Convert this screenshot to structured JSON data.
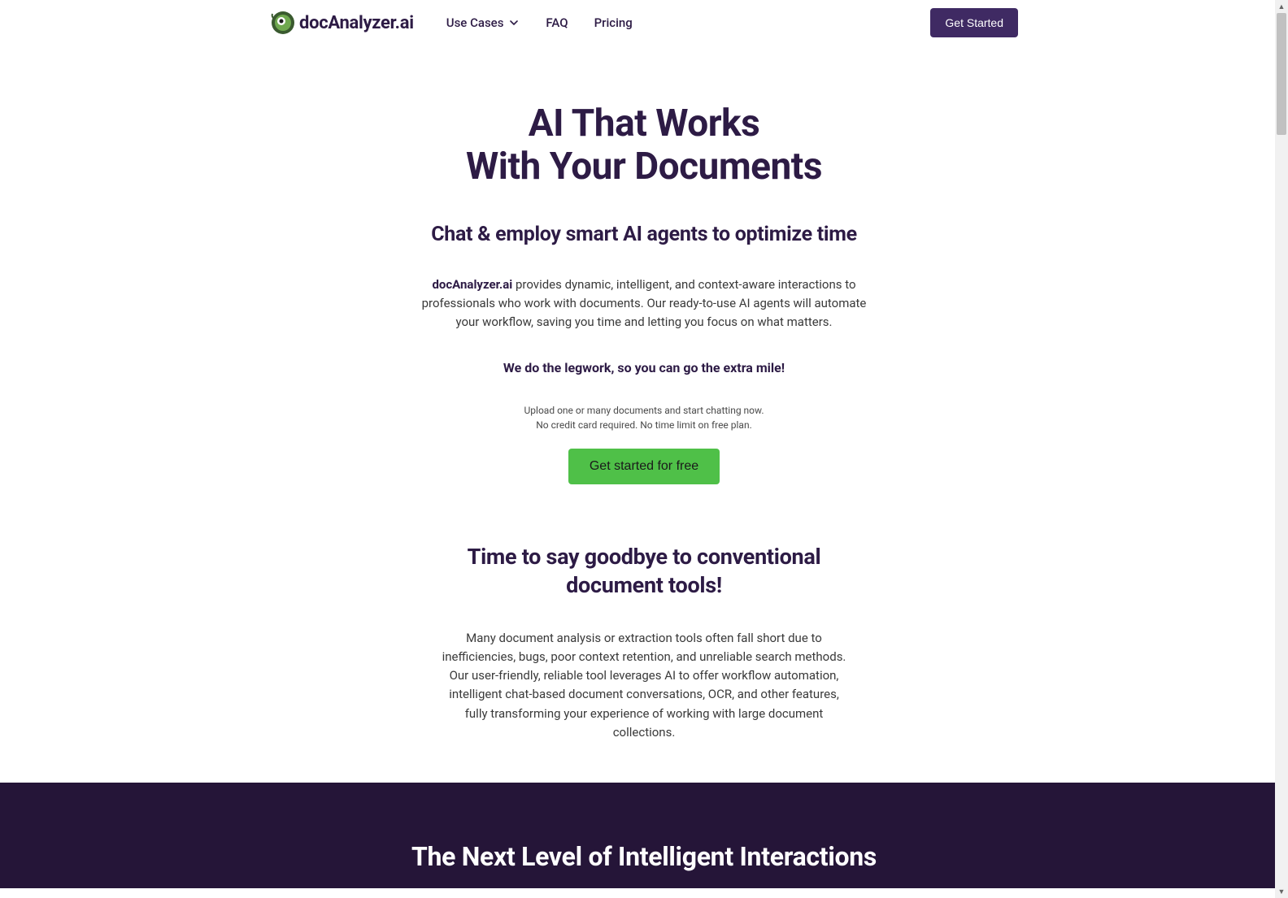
{
  "header": {
    "logo_text": "docAnalyzer.ai",
    "nav": {
      "use_cases": "Use Cases",
      "faq": "FAQ",
      "pricing": "Pricing"
    },
    "get_started_label": "Get Started"
  },
  "hero": {
    "title_line1": "AI That Works",
    "title_line2": "With Your Documents",
    "subtitle": "Chat & employ smart AI agents to optimize time",
    "description_bold": "docAnalyzer.ai",
    "description_rest": " provides dynamic, intelligent, and context-aware interactions to professionals who work with documents. Our ready-to-use AI agents will automate your workflow, saving you time and letting you focus on what matters.",
    "tagline": "We do the legwork, so you can go the extra mile!",
    "small_text_line1": "Upload one or many documents and start chatting now.",
    "small_text_line2": "No credit card required. No time limit on free plan.",
    "cta_label": "Get started for free"
  },
  "section2": {
    "title": "Time to say goodbye to conventional document tools!",
    "description": "Many document analysis or extraction tools often fall short due to inefficiencies, bugs, poor context retention, and unreliable search methods. Our user-friendly, reliable tool leverages AI to offer workflow automation, intelligent chat-based document conversations, OCR, and other features, fully transforming your experience of working with large document collections."
  },
  "dark_section": {
    "title": "The Next Level of Intelligent Interactions"
  }
}
